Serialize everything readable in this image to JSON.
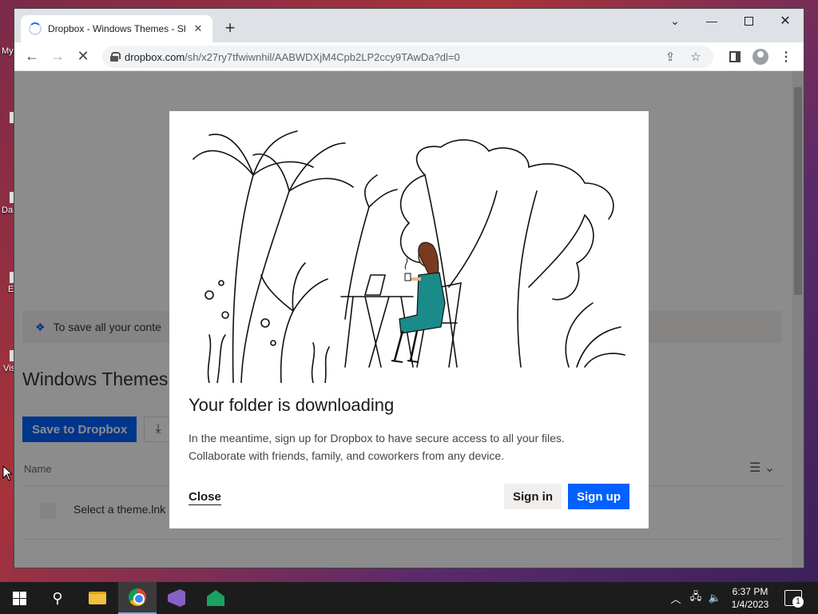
{
  "desktop": {
    "labels": [
      "My",
      "Da",
      "E",
      "Vis"
    ]
  },
  "browser": {
    "tab_title": "Dropbox - Windows Themes - Sh",
    "url_host": "dropbox.com",
    "url_path": "/sh/x27ry7tfwiwnhil/AABWDXjM4Cpb2LP2ccy9TAwDa?dl=0"
  },
  "page": {
    "banner_text": "To save all your conte",
    "title": "Windows Themes",
    "save_label": "Save to Dropbox",
    "col_name": "Name",
    "row_name": "Select a theme.lnk"
  },
  "modal": {
    "title": "Your folder is downloading",
    "body_line1": "In the meantime, sign up for Dropbox to have secure access to all your files.",
    "body_line2": "Collaborate with friends, family, and coworkers from any device.",
    "close_label": "Close",
    "signin_label": "Sign in",
    "signup_label": "Sign up"
  },
  "taskbar": {
    "time": "6:37 PM",
    "date": "1/4/2023",
    "notification_count": "1"
  }
}
